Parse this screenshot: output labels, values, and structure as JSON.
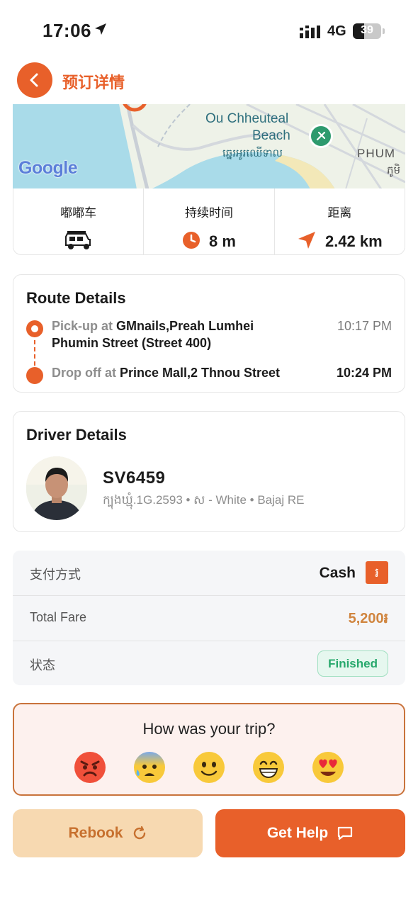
{
  "status_bar": {
    "time": "17:06",
    "network": "4G",
    "battery": "39",
    "battery_level": 0.39
  },
  "header": {
    "title": "预订详情"
  },
  "map": {
    "label_place": "Ou Chheuteal",
    "label_place2": "Beach",
    "label_khmer": "ឆ្នេរអូរឈើទាល",
    "label_phum": "PHUM",
    "label_phum_km": "ភូមិ",
    "google": "Google"
  },
  "trip_stats": {
    "vehicle_label": "嘟嘟车",
    "duration_label": "持续时间",
    "duration_value": "8 m",
    "distance_label": "距离",
    "distance_value": "2.42 km",
    "vehicle_icon": "tuk-tuk-icon",
    "duration_icon": "clock-icon",
    "distance_icon": "navigation-arrow-icon"
  },
  "route": {
    "title": "Route Details",
    "pickup_prefix": "Pick-up at",
    "pickup_place_line1": "GMnails,Preah Lumhei",
    "pickup_place_line2": "Phumin Street (Street 400)",
    "pickup_time": "10:17 PM",
    "dropoff_prefix": "Drop off at",
    "dropoff_place": "Prince Mall,2 Thnou Street",
    "dropoff_time": "10:24 PM"
  },
  "driver": {
    "title": "Driver Details",
    "plate": "SV6459",
    "details": "ក្បុងឃ្មុំ.1G.2593 • ស - White • Bajaj RE"
  },
  "payment": {
    "method_label": "支付方式",
    "method_value": "Cash",
    "currency_symbol": "៛",
    "fare_label": "Total Fare",
    "fare_value": "5,200៛",
    "status_label": "状态",
    "status_value": "Finished"
  },
  "rating": {
    "question": "How was your trip?",
    "options": [
      "angry-face",
      "anxious-face-with-sweat",
      "slightly-smiling-face",
      "grinning-face",
      "heart-eyes-face"
    ]
  },
  "actions": {
    "rebook_label": "Rebook",
    "help_label": "Get Help"
  },
  "colors": {
    "accent": "#e8602a",
    "fare": "#d0853f",
    "success": "#27a86c",
    "rebook_bg": "#f7d9b1"
  }
}
